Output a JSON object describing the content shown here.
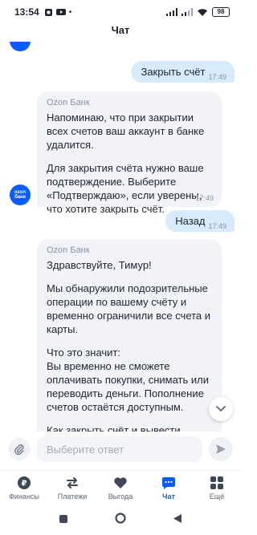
{
  "status_bar": {
    "time": "13:54",
    "battery": "98"
  },
  "header": {
    "title": "Чат"
  },
  "messages": [
    {
      "type": "outgoing",
      "text": "Закрыть счёт",
      "time": "17:49"
    },
    {
      "type": "incoming",
      "sender": "Ozon Банк",
      "paragraphs": [
        "Напоминаю, что при закрытии всех счетов ваш аккаунт в банке удалится.",
        "Для закрытия счёта нужно ваше подтверждение. Выберите «Подтверждаю», если уверены, что хотите закрыть счёт."
      ],
      "time": "17:49"
    },
    {
      "type": "outgoing",
      "text": "Назад",
      "time": "17:49"
    },
    {
      "type": "incoming",
      "sender": "Ozon Банк",
      "paragraphs": [
        "Здравствуйте, Тимур!",
        "Мы обнаружили подозрительные операции по вашему счёту и временно ограничили все счета и карты.",
        "Что это значит:\nВы временно не сможете оплачивать покупки, снимать или переводить деньги. Пополнение счетов остаётся доступным.",
        "Как закрыть счёт и вывести деньги:\nВ чате выберите «Закрыть счёт» и нажмите перевести"
      ]
    }
  ],
  "avatar": {
    "line1": "ozon",
    "line2": "банк"
  },
  "composer": {
    "placeholder": "Выберите ответ"
  },
  "bottom_nav": {
    "items": [
      {
        "label": "Финансы",
        "icon": "ruble-coin-icon"
      },
      {
        "label": "Платежи",
        "icon": "transfer-arrows-icon"
      },
      {
        "label": "Выгода",
        "icon": "heart-icon"
      },
      {
        "label": "Чат",
        "icon": "chat-icon",
        "active": true
      },
      {
        "label": "Ещё",
        "icon": "grid-icon"
      }
    ]
  },
  "colors": {
    "accent": "#0a5cff",
    "outgoing_bubble": "#d7ebfc",
    "incoming_bubble": "#f1f3f8"
  }
}
